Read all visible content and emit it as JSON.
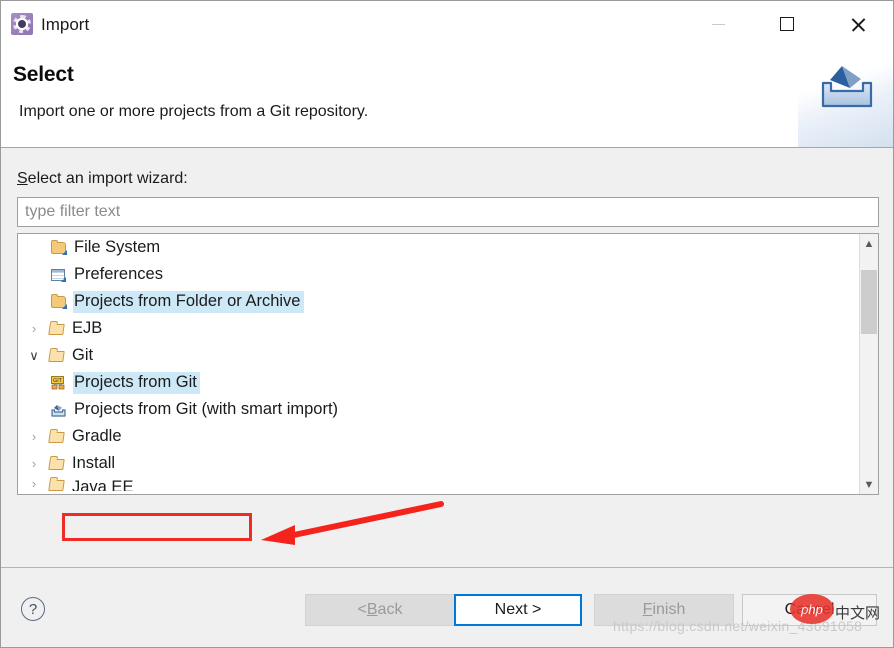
{
  "window": {
    "title": "Import",
    "icon": "eclipse-wizard-icon",
    "controls": {
      "minimize": "minimize-icon",
      "maximize": "maximize-icon",
      "close": "close-icon"
    }
  },
  "header": {
    "title": "Select",
    "description": "Import one or more projects from a Git repository.",
    "banner_icon": "import-banner-icon"
  },
  "main": {
    "field_label_prefix": "S",
    "field_label_rest": "elect an import wizard:",
    "filter": {
      "value": "",
      "placeholder": "type filter text"
    },
    "tree": [
      {
        "label": "File System",
        "icon": "folder-closed-icon",
        "indent": 2,
        "twisty": "",
        "state": "normal"
      },
      {
        "label": "Preferences",
        "icon": "preferences-icon",
        "indent": 2,
        "twisty": "",
        "state": "normal"
      },
      {
        "label": "Projects from Folder or Archive",
        "icon": "folder-closed-icon",
        "indent": 2,
        "twisty": "",
        "state": "highlighted"
      },
      {
        "label": "EJB",
        "icon": "folder-open-icon",
        "indent": 1,
        "twisty": "›",
        "state": "normal"
      },
      {
        "label": "Git",
        "icon": "folder-open-icon",
        "indent": 1,
        "twisty": "∨",
        "state": "normal"
      },
      {
        "label": "Projects from Git",
        "icon": "git-icon",
        "indent": 2,
        "twisty": "",
        "state": "selected"
      },
      {
        "label": "Projects from Git (with smart import)",
        "icon": "smart-import-icon",
        "indent": 2,
        "twisty": "",
        "state": "normal"
      },
      {
        "label": "Gradle",
        "icon": "folder-open-icon",
        "indent": 1,
        "twisty": "›",
        "state": "normal"
      },
      {
        "label": "Install",
        "icon": "folder-open-icon",
        "indent": 1,
        "twisty": "›",
        "state": "normal"
      },
      {
        "label": "Java EE",
        "icon": "folder-open-icon",
        "indent": 1,
        "twisty": "›",
        "state": "clipped"
      }
    ],
    "scrollbar": {
      "up_arrow": "chevron-up-icon",
      "down_arrow": "chevron-down-icon"
    }
  },
  "footer": {
    "help": "?",
    "buttons": {
      "back_prefix": "< ",
      "back_mnemonic": "B",
      "back_rest": "ack",
      "next": "Next >",
      "finish_mnemonic": "F",
      "finish_rest": "inish",
      "cancel": "Cancel"
    }
  },
  "annotations": {
    "highlight_box": "red-rectangle-around-projects-from-git",
    "arrow": "red-arrow-pointing-to-projects-from-git"
  },
  "watermark": {
    "url": "https://blog.csdn.net/weixin_43691058",
    "logo": "php",
    "site": "中文网"
  },
  "colors": {
    "selection": "#cde8f6",
    "accent": "#0078d7",
    "annotation": "#ee2b24",
    "dialog_bg": "#f0f0f0"
  }
}
